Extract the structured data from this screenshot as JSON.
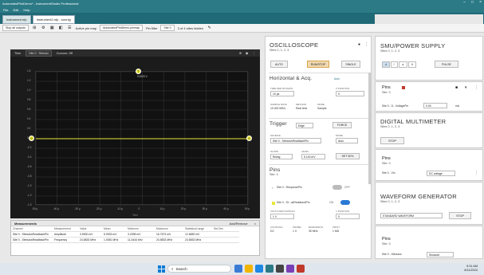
{
  "window": {
    "title": "AutomatedPlotDemo* - InstrumentStudio Professional",
    "controls": [
      "–",
      "□",
      "×"
    ]
  },
  "menu": [
    "File",
    "Edit",
    "Help"
  ],
  "tabs": [
    {
      "label": "Instrument.nfp"
    },
    {
      "label": "Instrument2.nfp - sonnig"
    }
  ],
  "tabbar_right": {
    "badge": "Sig InstrumentStudi",
    "icons": [
      "≡",
      "⌄"
    ]
  },
  "toolbar": {
    "stop_all": "Stop all outputs",
    "active_pin_map": "Active pin map",
    "pin_map_file": "AutomatedPlotDemo.pinmap",
    "pin_filter": "Pin filter",
    "site_filter": "Site 0",
    "sites_count": "3 of 4 sites hidden"
  },
  "scope_view": {
    "time_label": "Time",
    "site_dropdown": "Site 0 · Stimulu",
    "cursors": "Cursors: Off",
    "y_ticks": [
      "1.5",
      "1.2",
      "1.0",
      "0.8",
      "0.6",
      "0.4",
      "0.2",
      "0",
      "-0.2",
      "-0.4",
      "-0.6",
      "-0.8",
      "-1.0",
      "-1.2",
      "-1.5"
    ],
    "x_ticks": [
      "-50 μ",
      "-40 μ",
      "-30 μ",
      "-20 μ",
      "-10 μ",
      "0",
      "10 μ",
      "20 μ",
      "30 μ",
      "40 μ",
      "50 μ"
    ],
    "trigger_marker": "T",
    "trigger_value": "0.0000 V",
    "channel_marker": "0",
    "time_axis_label": "Time"
  },
  "measurements": {
    "title": "Measurements",
    "add_remove": "Add/Remove",
    "headers": [
      "Channel",
      "Measurement",
      "Value",
      "Mean",
      "Minimum",
      "Maximum",
      "Statistical range",
      "Std Dev"
    ],
    "rows": [
      [
        "Site 0 - StimulusReadbackPin",
        "Amplitude",
        "3.5900 mV",
        "5.0933 mV",
        "3.2098 mV",
        "16.7673 mV",
        "12.6659 mV",
        ""
      ],
      [
        "Site 0 - StimulusReadbackPin",
        "Frequency",
        "24.5833 MHz",
        "1.0081 MHz",
        "11.4444 kHz",
        "24.5833 MHz",
        "24.5833 MHz",
        ""
      ]
    ]
  },
  "oscilloscope": {
    "title": "OSCILLOSCOPE",
    "sites": "Sites 0, 1, 2, 3",
    "auto": "AUTO",
    "run_stop": "RUN/STOP",
    "single": "SINGLE",
    "horiz_title": "Horizontal & Acq.",
    "horiz_auto": "Auto",
    "time_per_div_label": "TIME PER DIVISION",
    "time_per_div": "10 μs",
    "x_position_label": "X POSITION",
    "x_position": "0",
    "sample_rate_label": "SAMPLE RATE",
    "sample_rate": "10.000 MS/s",
    "method_label": "METHOD",
    "method": "Real time",
    "mode_label": "MODE",
    "mode": "Sample",
    "trigger_title": "Trigger",
    "trigger_type": "Edge",
    "force": "FORCE",
    "source_label": "SOURCE",
    "source": "Site 0 - StimulusReadbackPin",
    "tmode_label": "MODE",
    "tmode": "Auto",
    "slope_label": "SLOPE",
    "slope": "Rising",
    "level_label": "LEVEL",
    "level": "5.140 mV",
    "set50": "SET 50%",
    "pins_title": "Pins",
    "pin_site": "Site: 0",
    "pin1": "Site 0 - ResponsePin",
    "pin1_state": "OFF",
    "pin2": "Site 0 - St...usReadbackPin",
    "pin2_state": "ON",
    "vdiv_label": "VOLTS PER DIVISION",
    "vdiv": "1 V",
    "ypos_label": "Y POSITION",
    "ypos": "0",
    "coupling_label": "COUPLING",
    "coupling": "DC",
    "probe_label": "PROBE",
    "probe": "1 X",
    "bw_label": "BANDWIDTH",
    "bw": "35 MHz",
    "input_label": "INPUT",
    "input": "1 MΩ",
    "colors": {
      "accent": "#2c7a86",
      "orange": "#d9a44b",
      "blue": "#2a7ad5",
      "yellow": "#e8e63a",
      "red": "#c0392b"
    }
  },
  "smu": {
    "title": "SMU/POWER SUPPLY",
    "sites": "Sites 0, 1, 2, 3",
    "pulse": "PULSE",
    "pins_title": "Pins",
    "pin_site": "Site: 0",
    "pin": "Site 0 - D...VoltagePin",
    "pin_value": "0.00",
    "unit": "mA"
  },
  "dmm": {
    "title": "DIGITAL MULTIMETER",
    "sites": "Sites 0, 1, 2, 3",
    "stop": "STOP",
    "pins_title": "Pins",
    "pin_site": "Site: 0",
    "pin": "Site 0 - Vin",
    "mode": "DC voltage"
  },
  "wfg": {
    "title": "WAVEFORM GENERATOR",
    "sites": "Sites 0, 1, 2, 3",
    "waveform": "STANDARD WAVEFORM",
    "stop": "STOP",
    "pins_title": "Pins",
    "pin_site": "Site: 0",
    "pin": "Site 0 - Stimulus",
    "func": "Sinusoid"
  },
  "taskbar": {
    "search": "Search",
    "time": "9:31 AM",
    "date": "8/11/2024"
  }
}
